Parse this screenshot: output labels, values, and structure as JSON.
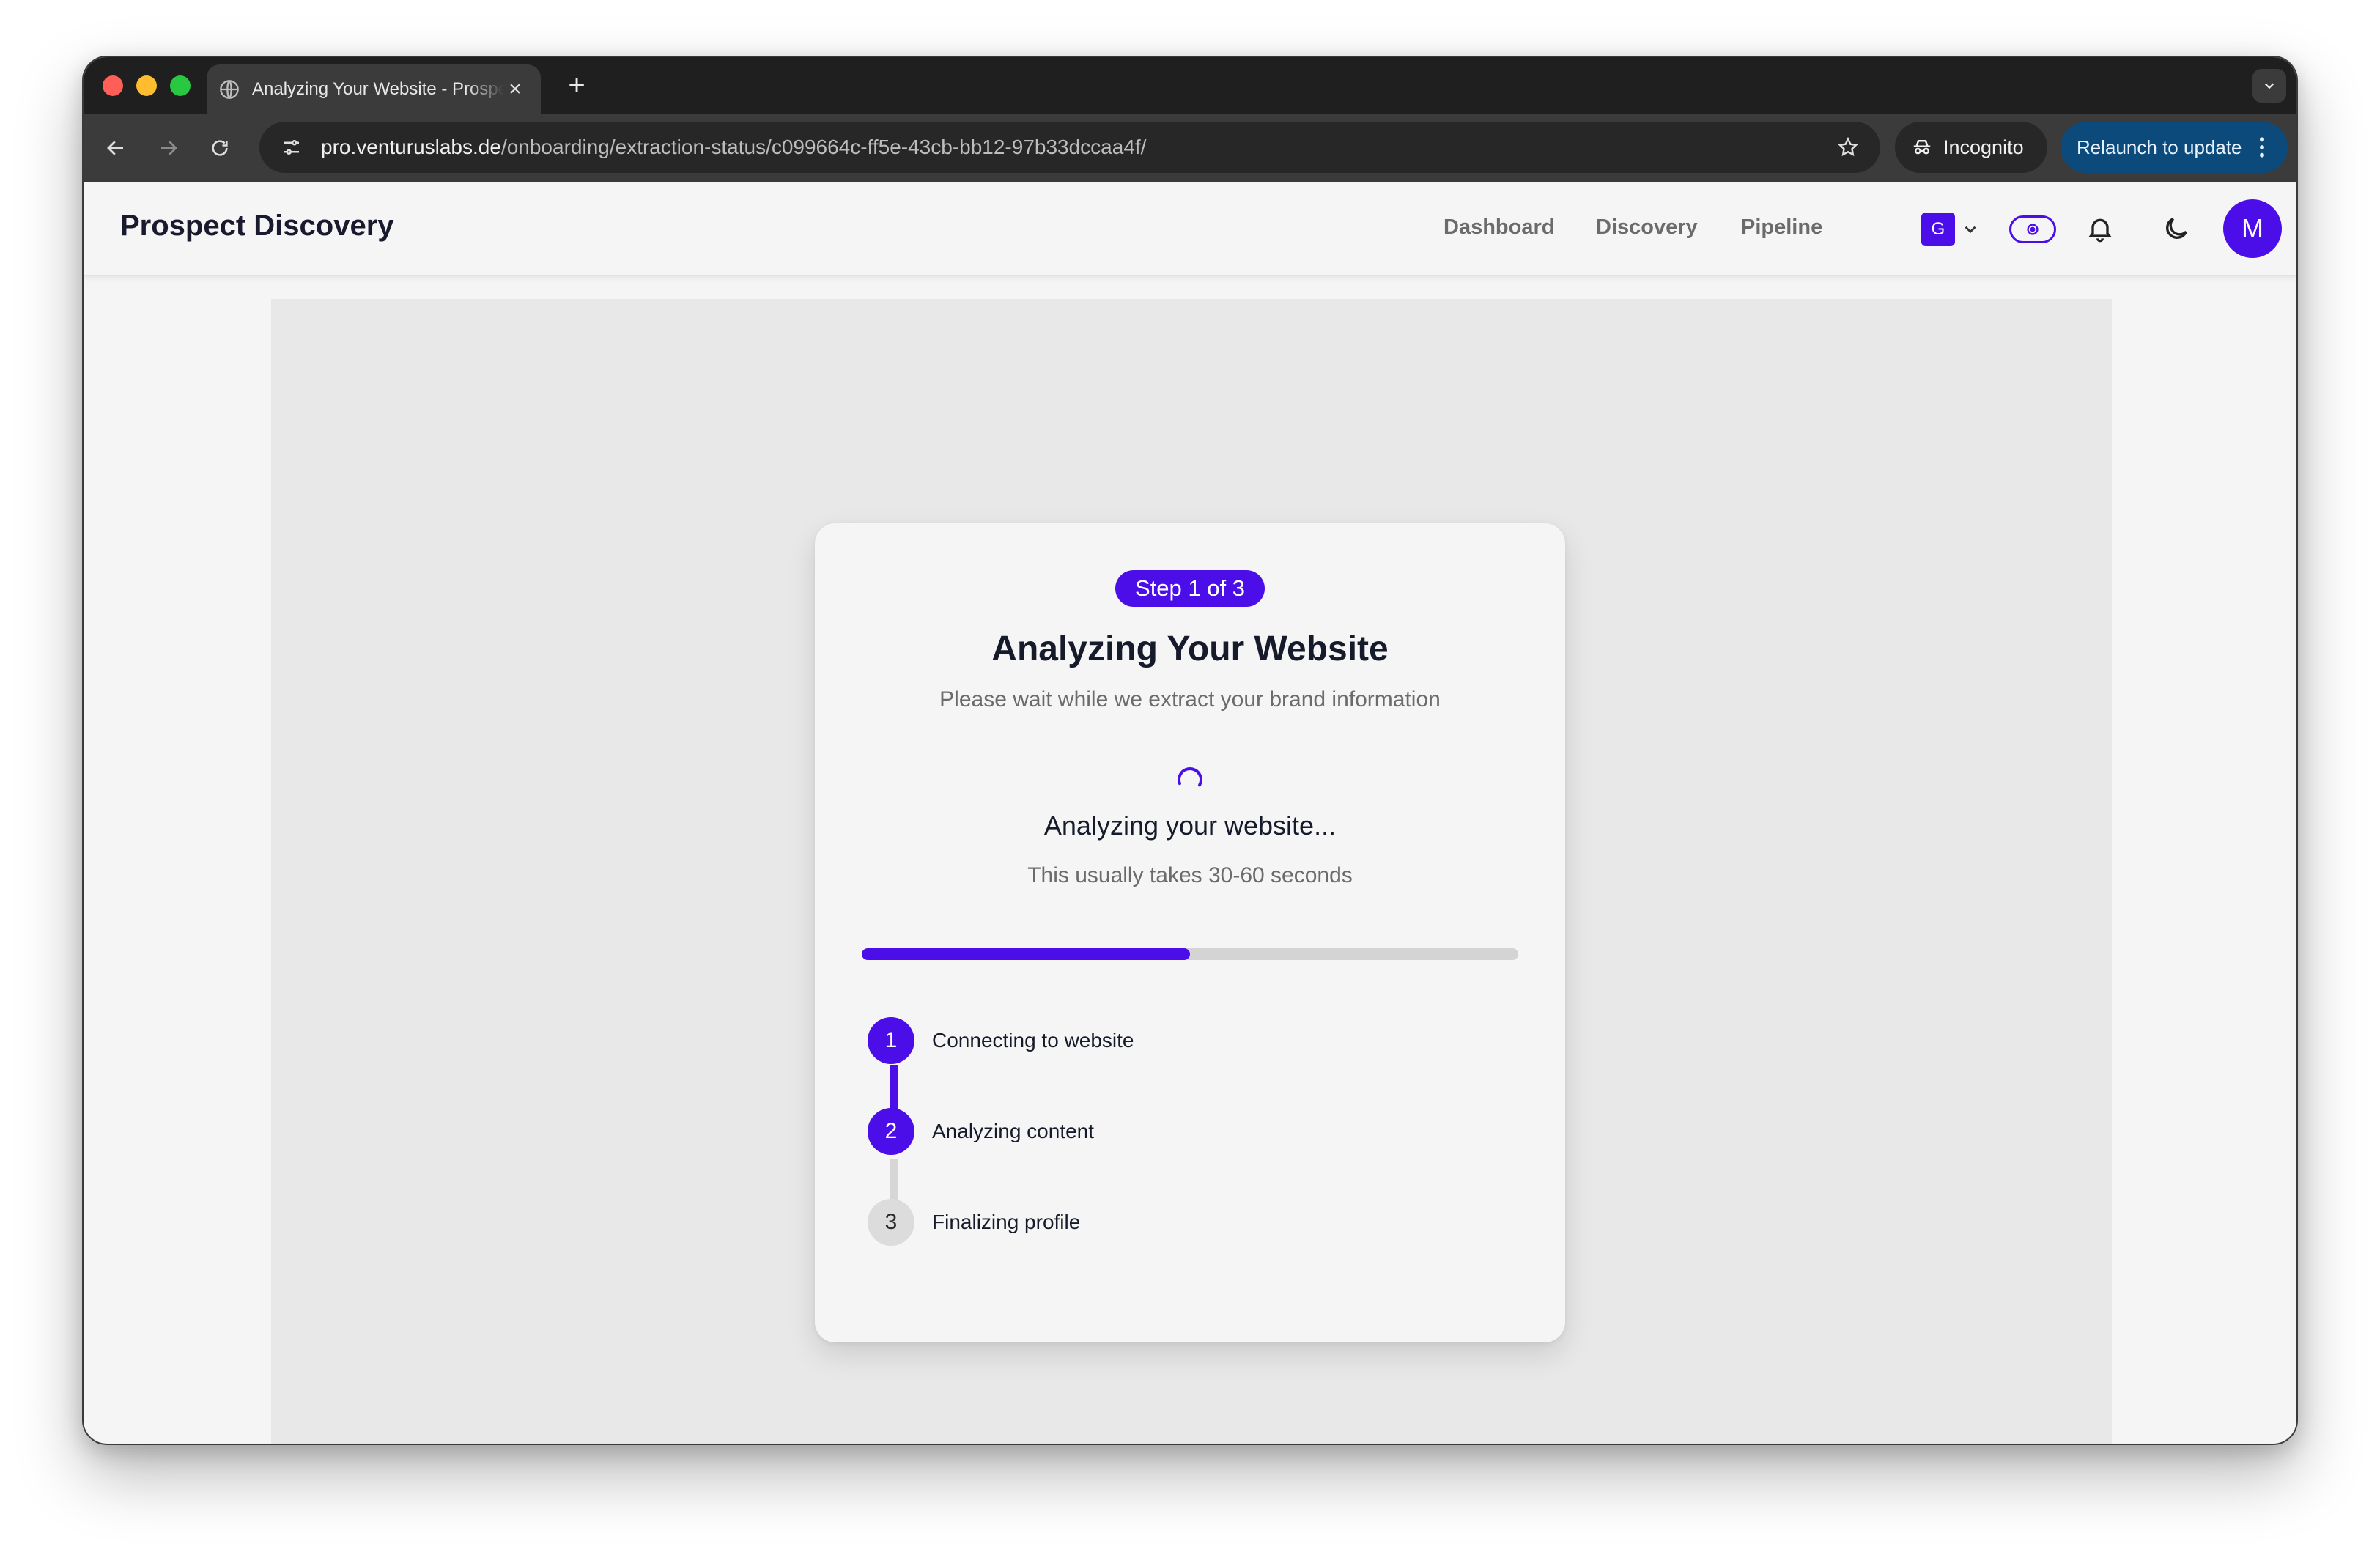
{
  "browser": {
    "tab_title": "Analyzing Your Website - Prospect Discovery",
    "url_host": "pro.venturuslabs.de",
    "url_path": "/onboarding/extraction-status/c099664c-ff5e-43cb-bb12-97b33dccaa4f/",
    "incognito_label": "Incognito",
    "relaunch_label": "Relaunch to update"
  },
  "header": {
    "brand": "Prospect Discovery",
    "nav": [
      {
        "label": "Dashboard"
      },
      {
        "label": "Discovery"
      },
      {
        "label": "Pipeline"
      }
    ],
    "org_initial": "G",
    "avatar_initial": "M"
  },
  "card": {
    "step_pill": "Step 1 of 3",
    "title": "Analyzing Your Website",
    "subtitle": "Please wait while we extract your brand information",
    "status_title": "Analyzing your website...",
    "status_sub": "This usually takes 30-60 seconds",
    "progress_percent": 50,
    "steps": [
      {
        "number": "1",
        "label": "Connecting to website",
        "state": "completed"
      },
      {
        "number": "2",
        "label": "Analyzing content",
        "state": "active"
      },
      {
        "number": "3",
        "label": "Finalizing profile",
        "state": "pending"
      }
    ]
  },
  "colors": {
    "accent": "#4b0ee8",
    "relaunch_bg": "#0b4a7a"
  },
  "icons": {
    "tab_favicon": "globe-icon",
    "back": "arrow-left-icon",
    "forward": "arrow-right-icon",
    "reload": "reload-icon",
    "site_info": "tune-icon",
    "bookmark": "star-icon",
    "incognito": "incognito-icon",
    "bell": "bell-icon",
    "theme": "moon-icon"
  }
}
